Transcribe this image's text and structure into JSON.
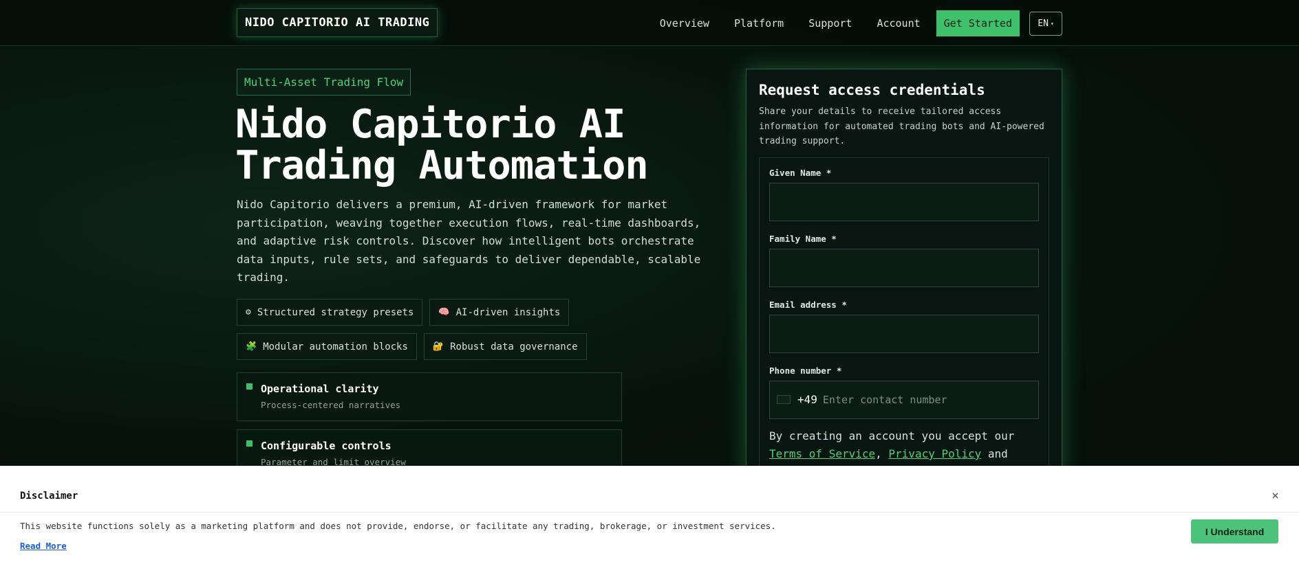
{
  "header": {
    "logo": "NIDO CAPITORIO AI TRADING",
    "nav": [
      "Overview",
      "Platform",
      "Support",
      "Account"
    ],
    "cta": "Get Started",
    "language": "EN",
    "language_caret": "▾"
  },
  "hero": {
    "tagline": "Multi-Asset Trading Flow",
    "title": "Nido Capitorio AI Trading Automation",
    "description": "Nido Capitorio delivers a premium, AI-driven framework for market participation, weaving together execution flows, real-time dashboards, and adaptive risk controls. Discover how intelligent bots orchestrate data inputs, rule sets, and safeguards to deliver dependable, scalable trading.",
    "chips": [
      {
        "icon": "⚙",
        "label": "Structured strategy presets"
      },
      {
        "icon": "🧠",
        "label": "AI-driven insights"
      },
      {
        "icon": "🧩",
        "label": "Modular automation blocks"
      },
      {
        "icon": "🔐",
        "label": "Robust data governance"
      }
    ],
    "cards": [
      {
        "title": "Operational clarity",
        "subtitle": "Process-centered narratives"
      },
      {
        "title": "Configurable controls",
        "subtitle": "Parameter and limit overview"
      }
    ]
  },
  "form": {
    "title": "Request access credentials",
    "subtitle": "Share your details to receive tailored access information for automated trading bots and AI-powered trading support.",
    "fields": {
      "given_name": "Given Name *",
      "family_name": "Family Name *",
      "email": "Email address *",
      "phone": "Phone number *"
    },
    "phone_code": "+49",
    "phone_placeholder": "Enter contact number",
    "terms_prefix": "By creating an account you accept our",
    "terms_link": "Terms of Service",
    "comma": ",",
    "privacy_link": "Privacy Policy",
    "and": "and"
  },
  "disclaimer": {
    "title": "Disclaimer",
    "close": "×",
    "text": "This website functions solely as a marketing platform and does not provide, endorse, or facilitate any trading, brokerage, or investment services.",
    "read_more": "Read More",
    "button": "I Understand"
  }
}
